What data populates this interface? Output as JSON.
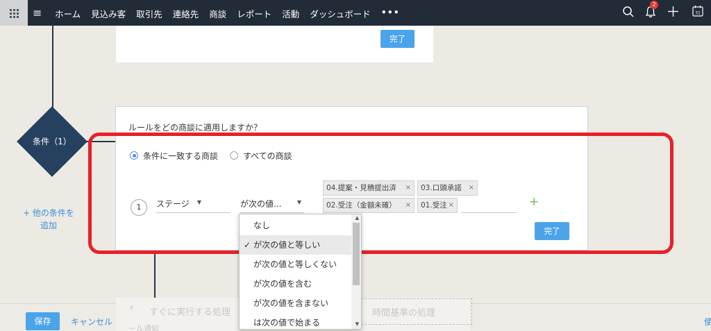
{
  "nav": {
    "items": [
      "ホーム",
      "見込み客",
      "取引先",
      "連絡先",
      "商談",
      "レポート",
      "活動",
      "ダッシュボード"
    ],
    "more": "•••",
    "menu_glyph": "≡",
    "notification_count": "2",
    "calendar_day": "31"
  },
  "top_card": {
    "done_label": "完了"
  },
  "workflow": {
    "condition_label": "条件（1）",
    "add_condition_line1": "+ 他の条件を",
    "add_condition_line2": "追加"
  },
  "rule_card": {
    "question": "ルールをどの商談に適用しますか？",
    "radio_match": "条件に一致する商談",
    "radio_all": "すべての商談",
    "row_number": "1",
    "field_select": "ステージ",
    "operator_select": "が次の値...",
    "chips": [
      "04.提案・見積提出済",
      "03.口頭承諾",
      "02.受注（金額未確）",
      "01.受注"
    ],
    "chip_remove": "×",
    "add_glyph": "+",
    "done_label": "完了"
  },
  "operator_dropdown": {
    "options": [
      "なし",
      "が次の値と等しい",
      "が次の値と等しくない",
      "が次の値を含む",
      "が次の値を含まない",
      "は次の値で始まる"
    ],
    "selected_index": 1,
    "check": "✓"
  },
  "background": {
    "instant_action": "すぐに実行する処理",
    "timed_action": "時間基準の処理",
    "partial_text": "ール通知"
  },
  "footer": {
    "save_label": "保存",
    "cancel_label": "キャンセル",
    "right_text": "使"
  },
  "colors": {
    "topbar": "#222b38",
    "accent_blue": "#4ba3ea",
    "diamond": "#26415f",
    "highlight_red": "#e8202a",
    "add_green": "#6fba3d"
  }
}
